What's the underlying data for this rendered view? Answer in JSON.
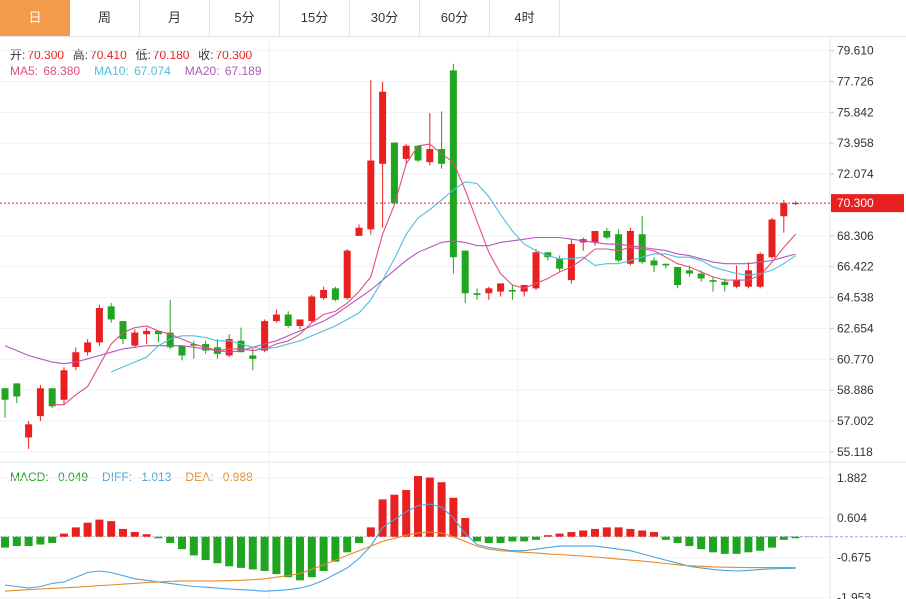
{
  "tabs": [
    {
      "label": "日",
      "active": true
    },
    {
      "label": "周",
      "active": false
    },
    {
      "label": "月",
      "active": false
    },
    {
      "label": "5分",
      "active": false
    },
    {
      "label": "15分",
      "active": false
    },
    {
      "label": "30分",
      "active": false
    },
    {
      "label": "60分",
      "active": false
    },
    {
      "label": "4时",
      "active": false
    }
  ],
  "ohlc_info": {
    "open_label": "开:",
    "open": "70.300",
    "high_label": "高:",
    "high": "70.410",
    "low_label": "低:",
    "low": "70.180",
    "close_label": "收:",
    "close": "70.300"
  },
  "ma_info": {
    "ma5_label": "MA5: ",
    "ma5": "68.380",
    "ma10_label": "MA10: ",
    "ma10": "67.074",
    "ma20_label": "MA20: ",
    "ma20": "67.189"
  },
  "macd_info": {
    "macd_label": "MACD: ",
    "macd": "-0.049",
    "diff_label": "DIFF: ",
    "diff": "-1.013",
    "dea_label": "DEA: ",
    "dea": "-0.988"
  },
  "colors": {
    "up": "#e8201f",
    "down": "#1fa51f",
    "ma5": "#e0507a",
    "ma10": "#4fbfd9",
    "ma20": "#b455c2",
    "diff": "#4aa3df",
    "dea": "#e8892b",
    "accent": "#f29c4b"
  },
  "chart_data": {
    "type": "candlestick",
    "price_axis": {
      "ticks": [
        "79.610",
        "77.726",
        "75.842",
        "73.958",
        "72.074",
        "70.300",
        "68.306",
        "66.422",
        "64.538",
        "62.654",
        "60.770",
        "58.886",
        "57.002",
        "55.118"
      ],
      "current": "70.300",
      "range": [
        54.5,
        80.5
      ]
    },
    "macd_axis": {
      "ticks": [
        "1.882",
        "0.604",
        "-0.675",
        "-1.953"
      ],
      "range": [
        -2.0,
        2.4
      ]
    },
    "candles": [
      [
        59.0,
        59.0,
        57.2,
        58.3
      ],
      [
        59.3,
        59.3,
        58.1,
        58.5
      ],
      [
        56.0,
        57.0,
        55.3,
        56.8
      ],
      [
        57.3,
        59.2,
        57.0,
        59.0
      ],
      [
        59.0,
        59.0,
        57.8,
        57.9
      ],
      [
        58.3,
        60.3,
        58.0,
        60.1
      ],
      [
        60.3,
        61.5,
        60.1,
        61.2
      ],
      [
        61.2,
        62.0,
        61.0,
        61.8
      ],
      [
        61.8,
        64.1,
        61.6,
        63.9
      ],
      [
        64.0,
        64.2,
        63.0,
        63.2
      ],
      [
        63.1,
        63.1,
        61.7,
        62.0
      ],
      [
        61.6,
        62.6,
        61.5,
        62.4
      ],
      [
        62.3,
        62.7,
        61.7,
        62.5
      ],
      [
        62.5,
        62.5,
        61.8,
        62.3
      ],
      [
        62.4,
        64.4,
        61.4,
        61.5
      ],
      [
        61.6,
        61.6,
        60.7,
        61.0
      ],
      [
        61.7,
        61.9,
        60.8,
        61.6
      ],
      [
        61.7,
        61.9,
        61.1,
        61.3
      ],
      [
        61.5,
        62.0,
        60.8,
        61.1
      ],
      [
        61.0,
        62.3,
        60.9,
        62.0
      ],
      [
        61.9,
        62.7,
        61.2,
        61.2
      ],
      [
        61.0,
        61.5,
        60.1,
        60.8
      ],
      [
        61.3,
        63.2,
        61.2,
        63.1
      ],
      [
        63.1,
        63.8,
        63.0,
        63.5
      ],
      [
        63.5,
        63.7,
        62.7,
        62.8
      ],
      [
        62.8,
        63.2,
        62.6,
        63.2
      ],
      [
        63.1,
        64.7,
        63.0,
        64.6
      ],
      [
        64.5,
        65.2,
        64.4,
        65.0
      ],
      [
        65.1,
        65.2,
        64.3,
        64.4
      ],
      [
        64.5,
        67.5,
        64.4,
        67.4
      ],
      [
        68.3,
        69.0,
        68.3,
        68.8
      ],
      [
        68.7,
        77.8,
        68.4,
        72.9
      ],
      [
        72.7,
        77.7,
        68.8,
        77.1
      ],
      [
        74.0,
        74.0,
        70.2,
        70.3
      ],
      [
        73.0,
        73.9,
        72.7,
        73.8
      ],
      [
        73.8,
        73.8,
        72.8,
        72.9
      ],
      [
        72.8,
        75.8,
        72.6,
        73.6
      ],
      [
        73.6,
        75.9,
        72.4,
        72.7
      ],
      [
        78.4,
        78.8,
        66.0,
        67.0
      ],
      [
        67.4,
        67.4,
        64.2,
        64.8
      ],
      [
        64.8,
        65.1,
        64.4,
        64.7
      ],
      [
        64.8,
        65.2,
        64.4,
        65.1
      ],
      [
        64.9,
        65.4,
        64.6,
        65.4
      ],
      [
        65.0,
        65.3,
        64.4,
        64.9
      ],
      [
        64.9,
        65.3,
        64.6,
        65.3
      ],
      [
        65.1,
        67.5,
        65.0,
        67.3
      ],
      [
        67.3,
        67.3,
        66.8,
        67.0
      ],
      [
        66.9,
        67.1,
        66.1,
        66.3
      ],
      [
        65.6,
        68.1,
        65.4,
        67.8
      ],
      [
        67.9,
        68.2,
        67.4,
        68.1
      ],
      [
        67.9,
        68.6,
        67.7,
        68.6
      ],
      [
        68.6,
        68.8,
        68.1,
        68.2
      ],
      [
        68.4,
        68.7,
        66.7,
        66.8
      ],
      [
        66.6,
        68.8,
        66.5,
        68.6
      ],
      [
        68.4,
        69.5,
        66.6,
        66.7
      ],
      [
        66.8,
        67.0,
        66.1,
        66.5
      ],
      [
        66.6,
        66.6,
        66.3,
        66.5
      ],
      [
        66.4,
        66.4,
        65.1,
        65.3
      ],
      [
        66.2,
        66.5,
        65.8,
        66.0
      ],
      [
        66.0,
        66.2,
        65.5,
        65.7
      ],
      [
        65.6,
        65.8,
        64.9,
        65.5
      ],
      [
        65.5,
        65.7,
        64.9,
        65.3
      ],
      [
        65.2,
        66.5,
        65.1,
        65.6
      ],
      [
        65.2,
        66.7,
        65.1,
        66.2
      ],
      [
        65.2,
        67.3,
        65.1,
        67.2
      ],
      [
        67.0,
        69.4,
        66.9,
        69.3
      ],
      [
        69.5,
        70.5,
        68.5,
        70.3
      ],
      [
        70.3,
        70.41,
        70.18,
        70.3
      ]
    ],
    "ma5": [
      null,
      null,
      null,
      null,
      58.0,
      58.0,
      58.6,
      59.1,
      60.4,
      61.7,
      62.4,
      62.7,
      62.8,
      62.5,
      62.3,
      62.0,
      61.7,
      61.5,
      61.3,
      61.4,
      61.4,
      61.3,
      61.4,
      61.7,
      61.9,
      62.3,
      63.0,
      63.5,
      63.7,
      64.2,
      64.9,
      65.8,
      68.4,
      70.2,
      72.7,
      73.8,
      73.9,
      73.3,
      72.8,
      71.1,
      69.2,
      67.3,
      66.0,
      65.3,
      65.1,
      65.4,
      65.7,
      66.1,
      66.4,
      66.9,
      67.5,
      67.5,
      67.4,
      67.6,
      67.5,
      67.4,
      67.0,
      66.6,
      66.4,
      66.1,
      65.8,
      65.6,
      65.6,
      65.6,
      65.9,
      66.7,
      67.6,
      68.4
    ],
    "ma10": [
      null,
      null,
      null,
      null,
      null,
      null,
      null,
      null,
      null,
      60.0,
      60.3,
      60.6,
      60.9,
      61.6,
      62.0,
      62.2,
      62.2,
      62.1,
      61.9,
      61.9,
      61.7,
      61.5,
      61.4,
      61.5,
      61.7,
      61.9,
      62.2,
      62.5,
      62.8,
      63.2,
      63.6,
      64.4,
      65.6,
      66.9,
      68.4,
      69.4,
      69.9,
      70.5,
      71.1,
      71.6,
      71.5,
      70.7,
      69.6,
      68.6,
      67.8,
      67.4,
      67.1,
      66.9,
      66.9,
      67.0,
      66.5,
      66.6,
      66.6,
      66.8,
      67.0,
      67.2,
      67.2,
      67.0,
      67.0,
      66.8,
      66.4,
      66.2,
      66.0,
      65.9,
      66.0,
      66.2,
      66.6,
      67.1
    ],
    "ma20": [
      61.6,
      61.3,
      61.0,
      60.8,
      60.6,
      60.5,
      60.6,
      60.8,
      61.0,
      61.2,
      61.4,
      61.5,
      61.6,
      61.6,
      61.6,
      61.6,
      61.5,
      61.4,
      61.3,
      61.2,
      61.3,
      61.5,
      61.7,
      61.9,
      62.2,
      62.5,
      62.8,
      63.1,
      63.5,
      64.0,
      64.5,
      65.0,
      65.6,
      66.2,
      66.8,
      67.3,
      67.6,
      67.9,
      68.0,
      67.9,
      67.7,
      67.7,
      67.9,
      68.0,
      68.1,
      68.2,
      68.2,
      68.2,
      68.1,
      68.0,
      67.9,
      67.8,
      67.8,
      67.7,
      67.6,
      67.5,
      67.4,
      67.2,
      67.1,
      66.9,
      66.7,
      66.6,
      66.6,
      66.6,
      66.7,
      66.8,
      67.0,
      67.19
    ],
    "macd": [
      -0.35,
      -0.3,
      -0.3,
      -0.25,
      -0.2,
      0.1,
      0.3,
      0.45,
      0.55,
      0.5,
      0.25,
      0.15,
      0.08,
      -0.05,
      -0.2,
      -0.4,
      -0.6,
      -0.75,
      -0.85,
      -0.95,
      -1.0,
      -1.05,
      -1.1,
      -1.2,
      -1.3,
      -1.4,
      -1.3,
      -1.1,
      -0.8,
      -0.5,
      -0.2,
      0.3,
      1.2,
      1.35,
      1.5,
      1.95,
      1.9,
      1.75,
      1.25,
      0.6,
      -0.15,
      -0.2,
      -0.2,
      -0.15,
      -0.15,
      -0.1,
      0.05,
      0.1,
      0.15,
      0.2,
      0.25,
      0.3,
      0.3,
      0.25,
      0.2,
      0.15,
      -0.1,
      -0.2,
      -0.3,
      -0.4,
      -0.5,
      -0.55,
      -0.55,
      -0.5,
      -0.45,
      -0.35,
      -0.1,
      -0.049
    ],
    "diff": [
      -1.55,
      -1.6,
      -1.65,
      -1.6,
      -1.5,
      -1.45,
      -1.3,
      -1.15,
      -1.1,
      -1.15,
      -1.25,
      -1.35,
      -1.4,
      -1.45,
      -1.5,
      -1.55,
      -1.6,
      -1.62,
      -1.65,
      -1.68,
      -1.7,
      -1.72,
      -1.75,
      -1.73,
      -1.7,
      -1.65,
      -1.55,
      -1.4,
      -1.2,
      -1.0,
      -0.7,
      -0.3,
      0.3,
      0.55,
      0.8,
      1.0,
      1.05,
      0.95,
      0.6,
      0.1,
      -0.25,
      -0.35,
      -0.4,
      -0.45,
      -0.45,
      -0.4,
      -0.35,
      -0.3,
      -0.3,
      -0.3,
      -0.3,
      -0.35,
      -0.4,
      -0.45,
      -0.55,
      -0.65,
      -0.75,
      -0.85,
      -0.95,
      -1.0,
      -1.05,
      -1.08,
      -1.1,
      -1.08,
      -1.05,
      -1.03,
      -1.02,
      -1.013
    ],
    "dea": [
      -1.75,
      -1.72,
      -1.7,
      -1.68,
      -1.66,
      -1.64,
      -1.62,
      -1.6,
      -1.57,
      -1.55,
      -1.52,
      -1.5,
      -1.47,
      -1.45,
      -1.43,
      -1.42,
      -1.42,
      -1.42,
      -1.42,
      -1.41,
      -1.4,
      -1.38,
      -1.35,
      -1.3,
      -1.25,
      -1.18,
      -1.05,
      -0.9,
      -0.75,
      -0.6,
      -0.45,
      -0.3,
      -0.15,
      -0.05,
      0.05,
      0.12,
      0.15,
      0.12,
      0.0,
      -0.15,
      -0.3,
      -0.4,
      -0.45,
      -0.47,
      -0.5,
      -0.52,
      -0.55,
      -0.57,
      -0.6,
      -0.62,
      -0.65,
      -0.68,
      -0.72,
      -0.75,
      -0.78,
      -0.82,
      -0.86,
      -0.9,
      -0.93,
      -0.95,
      -0.97,
      -0.98,
      -0.985,
      -0.99,
      -0.99,
      -0.99,
      -0.988,
      -0.988
    ]
  }
}
